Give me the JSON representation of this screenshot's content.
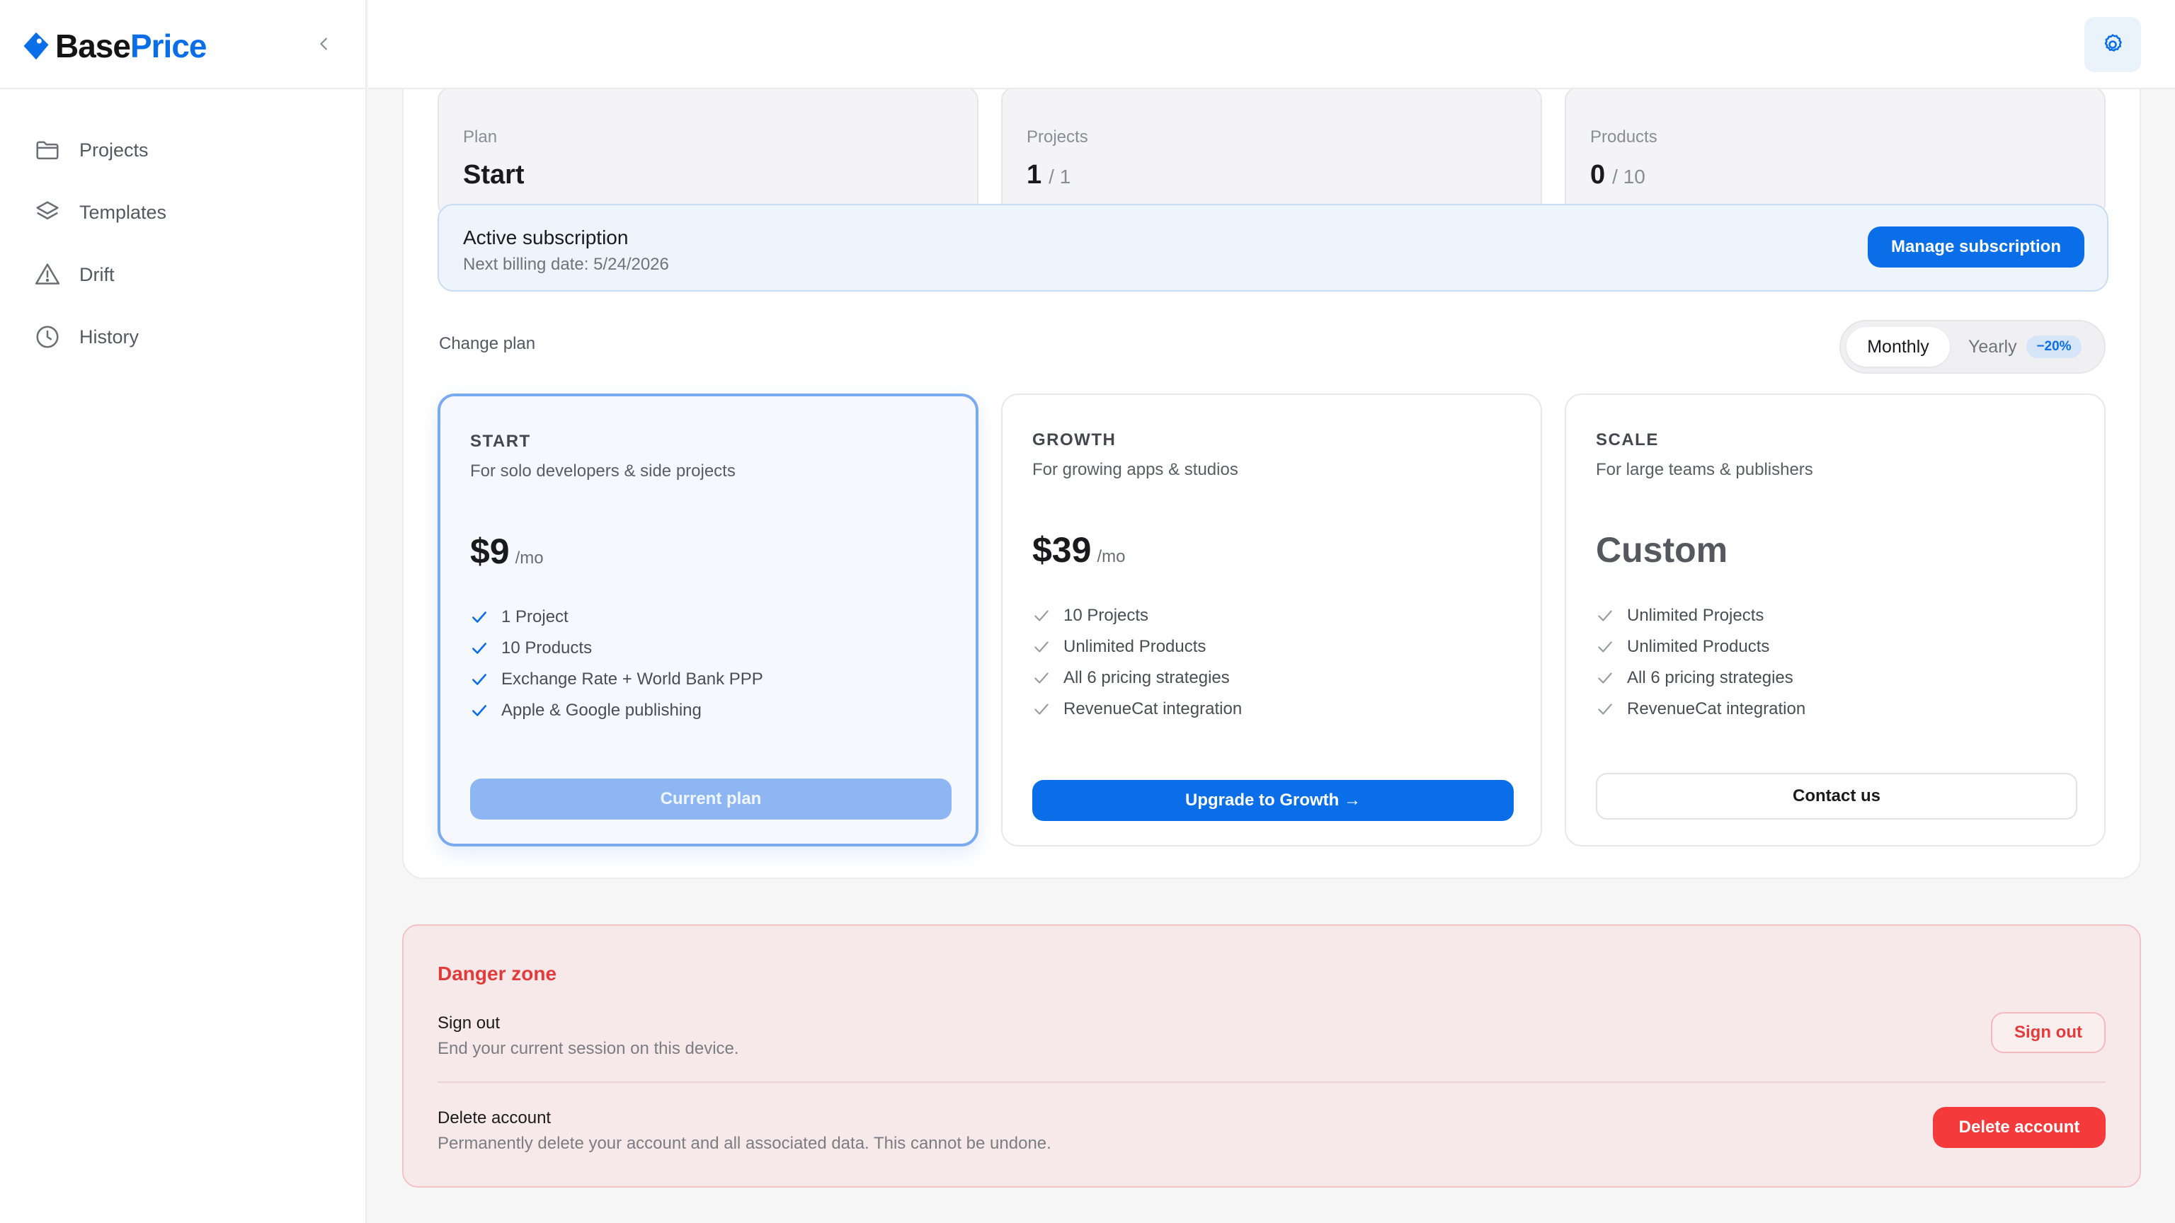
{
  "app": {
    "logo_base": "Base",
    "logo_price": "Price"
  },
  "sidebar": {
    "items": [
      {
        "label": "Projects",
        "icon": "folder-icon"
      },
      {
        "label": "Templates",
        "icon": "layers-icon"
      },
      {
        "label": "Drift",
        "icon": "warning-icon"
      },
      {
        "label": "History",
        "icon": "clock-icon"
      }
    ]
  },
  "stats": [
    {
      "label": "Plan",
      "value": "Start"
    },
    {
      "label": "Projects",
      "value": "1",
      "of": "/ 1"
    },
    {
      "label": "Products",
      "value": "0",
      "of": "/ 10"
    }
  ],
  "subscription": {
    "title": "Active subscription",
    "next_billing": "Next billing date: 5/24/2026",
    "manage_label": "Manage subscription"
  },
  "change_plan": {
    "label": "Change plan",
    "toggle": {
      "monthly": "Monthly",
      "yearly": "Yearly",
      "yearly_badge": "−20%",
      "selected": "Monthly"
    }
  },
  "plans": [
    {
      "name": "START",
      "desc": "For solo developers & side projects",
      "price": "$9",
      "per": "/mo",
      "features": [
        "1 Project",
        "10 Products",
        "Exchange Rate + World Bank PPP",
        "Apple & Google publishing"
      ],
      "button": "Current plan"
    },
    {
      "name": "GROWTH",
      "desc": "For growing apps & studios",
      "price": "$39",
      "per": "/mo",
      "features": [
        "10 Projects",
        "Unlimited Products",
        "All 6 pricing strategies",
        "RevenueCat integration"
      ],
      "button": "Upgrade to Growth →"
    },
    {
      "name": "SCALE",
      "desc": "For large teams & publishers",
      "price": "Custom",
      "features": [
        "Unlimited Projects",
        "Unlimited Products",
        "All 6 pricing strategies",
        "RevenueCat integration"
      ],
      "button": "Contact us"
    }
  ],
  "danger": {
    "title": "Danger zone",
    "signout_title": "Sign out",
    "signout_desc": "End your current session on this device.",
    "signout_btn": "Sign out",
    "delete_title": "Delete account",
    "delete_desc": "Permanently delete your account and all associated data. This cannot be undone.",
    "delete_btn": "Delete account"
  },
  "colors": {
    "accent": "#0a6ee8",
    "danger": "#f43a3a"
  }
}
